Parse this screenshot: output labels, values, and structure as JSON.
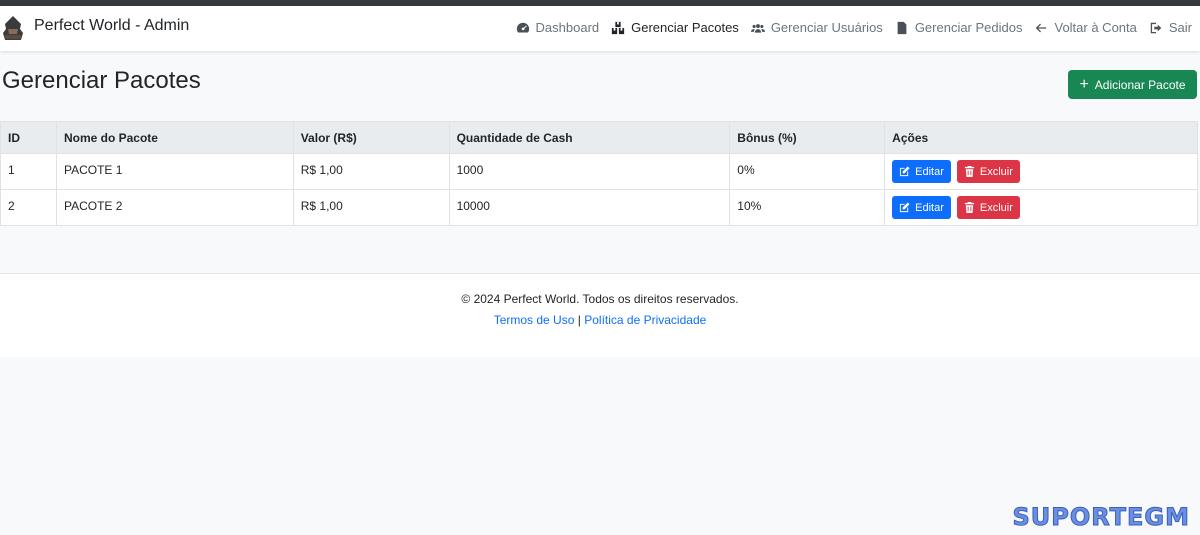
{
  "app": {
    "brand": "Perfect World - Admin"
  },
  "nav": [
    {
      "label": "Dashboard",
      "icon": "gauge-icon",
      "active": false
    },
    {
      "label": "Gerenciar Pacotes",
      "icon": "boxes-icon",
      "active": true
    },
    {
      "label": "Gerenciar Usuários",
      "icon": "users-icon",
      "active": false
    },
    {
      "label": "Gerenciar Pedidos",
      "icon": "receipt-icon",
      "active": false
    },
    {
      "label": "Voltar à Conta",
      "icon": "arrow-left-icon",
      "active": false
    },
    {
      "label": "Sair",
      "icon": "sign-out-icon",
      "active": false
    }
  ],
  "page": {
    "title": "Gerenciar Pacotes",
    "add_button": "Adicionar Pacote"
  },
  "table": {
    "headers": [
      "ID",
      "Nome do Pacote",
      "Valor (R$)",
      "Quantidade de Cash",
      "Bônus (%)",
      "Ações"
    ],
    "rows": [
      {
        "id": "1",
        "name": "PACOTE 1",
        "value": "R$ 1,00",
        "cash": "1000",
        "bonus": "0%"
      },
      {
        "id": "2",
        "name": "PACOTE 2",
        "value": "R$ 1,00",
        "cash": "10000",
        "bonus": "10%"
      }
    ],
    "edit_label": "Editar",
    "delete_label": "Excluir"
  },
  "footer": {
    "copyright": "© 2024 Perfect World. Todos os direitos reservados.",
    "terms": "Termos de Uso",
    "separator": "|",
    "privacy": "Política de Privacidade"
  },
  "watermark": "SUPORTEGM",
  "colors": {
    "primary": "#0d6efd",
    "success": "#198754",
    "danger": "#dc3545"
  }
}
